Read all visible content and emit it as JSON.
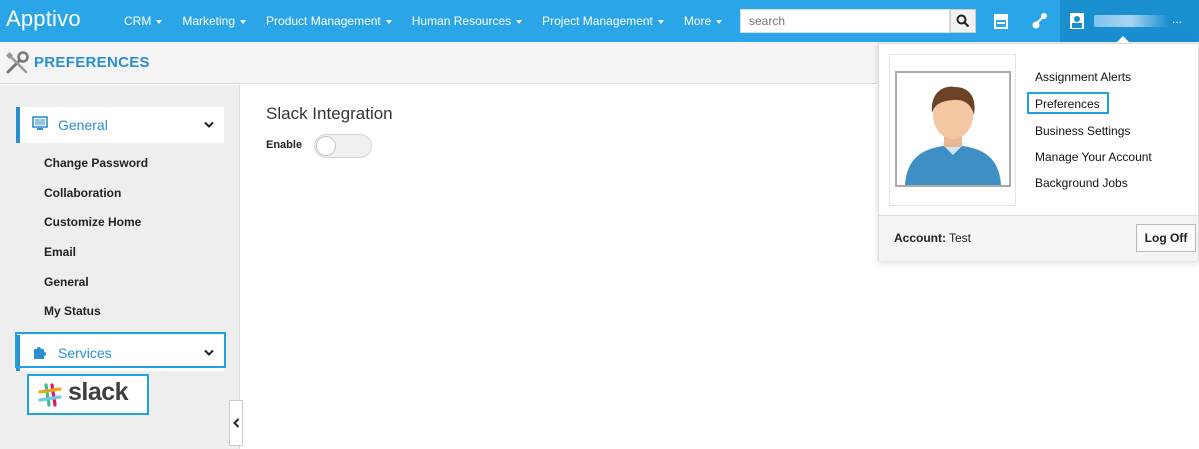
{
  "app": {
    "logo": "Apptivo"
  },
  "nav": {
    "items": [
      {
        "label": "CRM"
      },
      {
        "label": "Marketing"
      },
      {
        "label": "Product Management"
      },
      {
        "label": "Human Resources"
      },
      {
        "label": "Project Management"
      },
      {
        "label": "More"
      }
    ],
    "search_placeholder": "search"
  },
  "header": {
    "title": "PREFERENCES"
  },
  "sidebar": {
    "general": {
      "label": "General"
    },
    "links": [
      {
        "label": "Change Password"
      },
      {
        "label": "Collaboration"
      },
      {
        "label": "Customize Home"
      },
      {
        "label": "Email"
      },
      {
        "label": "General"
      },
      {
        "label": "My Status"
      }
    ],
    "services": {
      "label": "Services"
    },
    "slack": {
      "label": "slack"
    }
  },
  "main": {
    "title": "Slack Integration",
    "enable_label": "Enable",
    "enabled": false
  },
  "user_menu": {
    "links": [
      {
        "label": "Assignment Alerts"
      },
      {
        "label": "Preferences"
      },
      {
        "label": "Business Settings"
      },
      {
        "label": "Manage Your Account"
      },
      {
        "label": "Background Jobs"
      }
    ],
    "account_label": "Account:",
    "account_value": "Test",
    "logoff_label": "Log Off",
    "more_indicator": "..."
  },
  "colors": {
    "topbar": "#2aa5e8",
    "accent": "#2a8fcf",
    "highlight": "#1ea2e0"
  }
}
